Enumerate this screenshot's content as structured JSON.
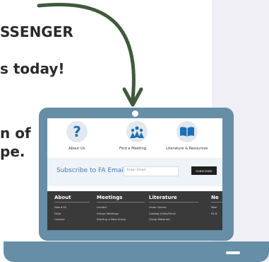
{
  "background_text": {
    "line1": "SSENGER",
    "line2": "s today!",
    "line3": "n of",
    "line4": "pe."
  },
  "screen": {
    "nav": [
      {
        "label": "About Us",
        "icon": "question-icon"
      },
      {
        "label": "Find a Meeting",
        "icon": "meeting-people-icon"
      },
      {
        "label": "Literature & Resources",
        "icon": "open-book-icon"
      }
    ],
    "subscribe": {
      "title": "Subscribe to FA Emails",
      "email_placeholder": "Enter Email",
      "button": "SUBSCRIBE"
    },
    "footer": {
      "columns": [
        {
          "heading": "About",
          "items": [
            "About FA",
            "FAQs",
            "Contact"
          ]
        },
        {
          "heading": "Meetings",
          "items": [
            "Locator",
            "Virtual Meetings",
            "Starting a New Group"
          ]
        },
        {
          "heading": "Literature",
          "items": [
            "Order Online",
            "Catalog (View/Print)",
            "Group Materials"
          ]
        },
        {
          "heading": "Ne",
          "items": [
            "Worl",
            "FA N"
          ]
        }
      ]
    }
  },
  "colors": {
    "laptop": "#668ea6",
    "arrow": "#3f5b3a",
    "footer_bg": "#3a3a3a",
    "accent_blue": "#1d6fb8"
  }
}
